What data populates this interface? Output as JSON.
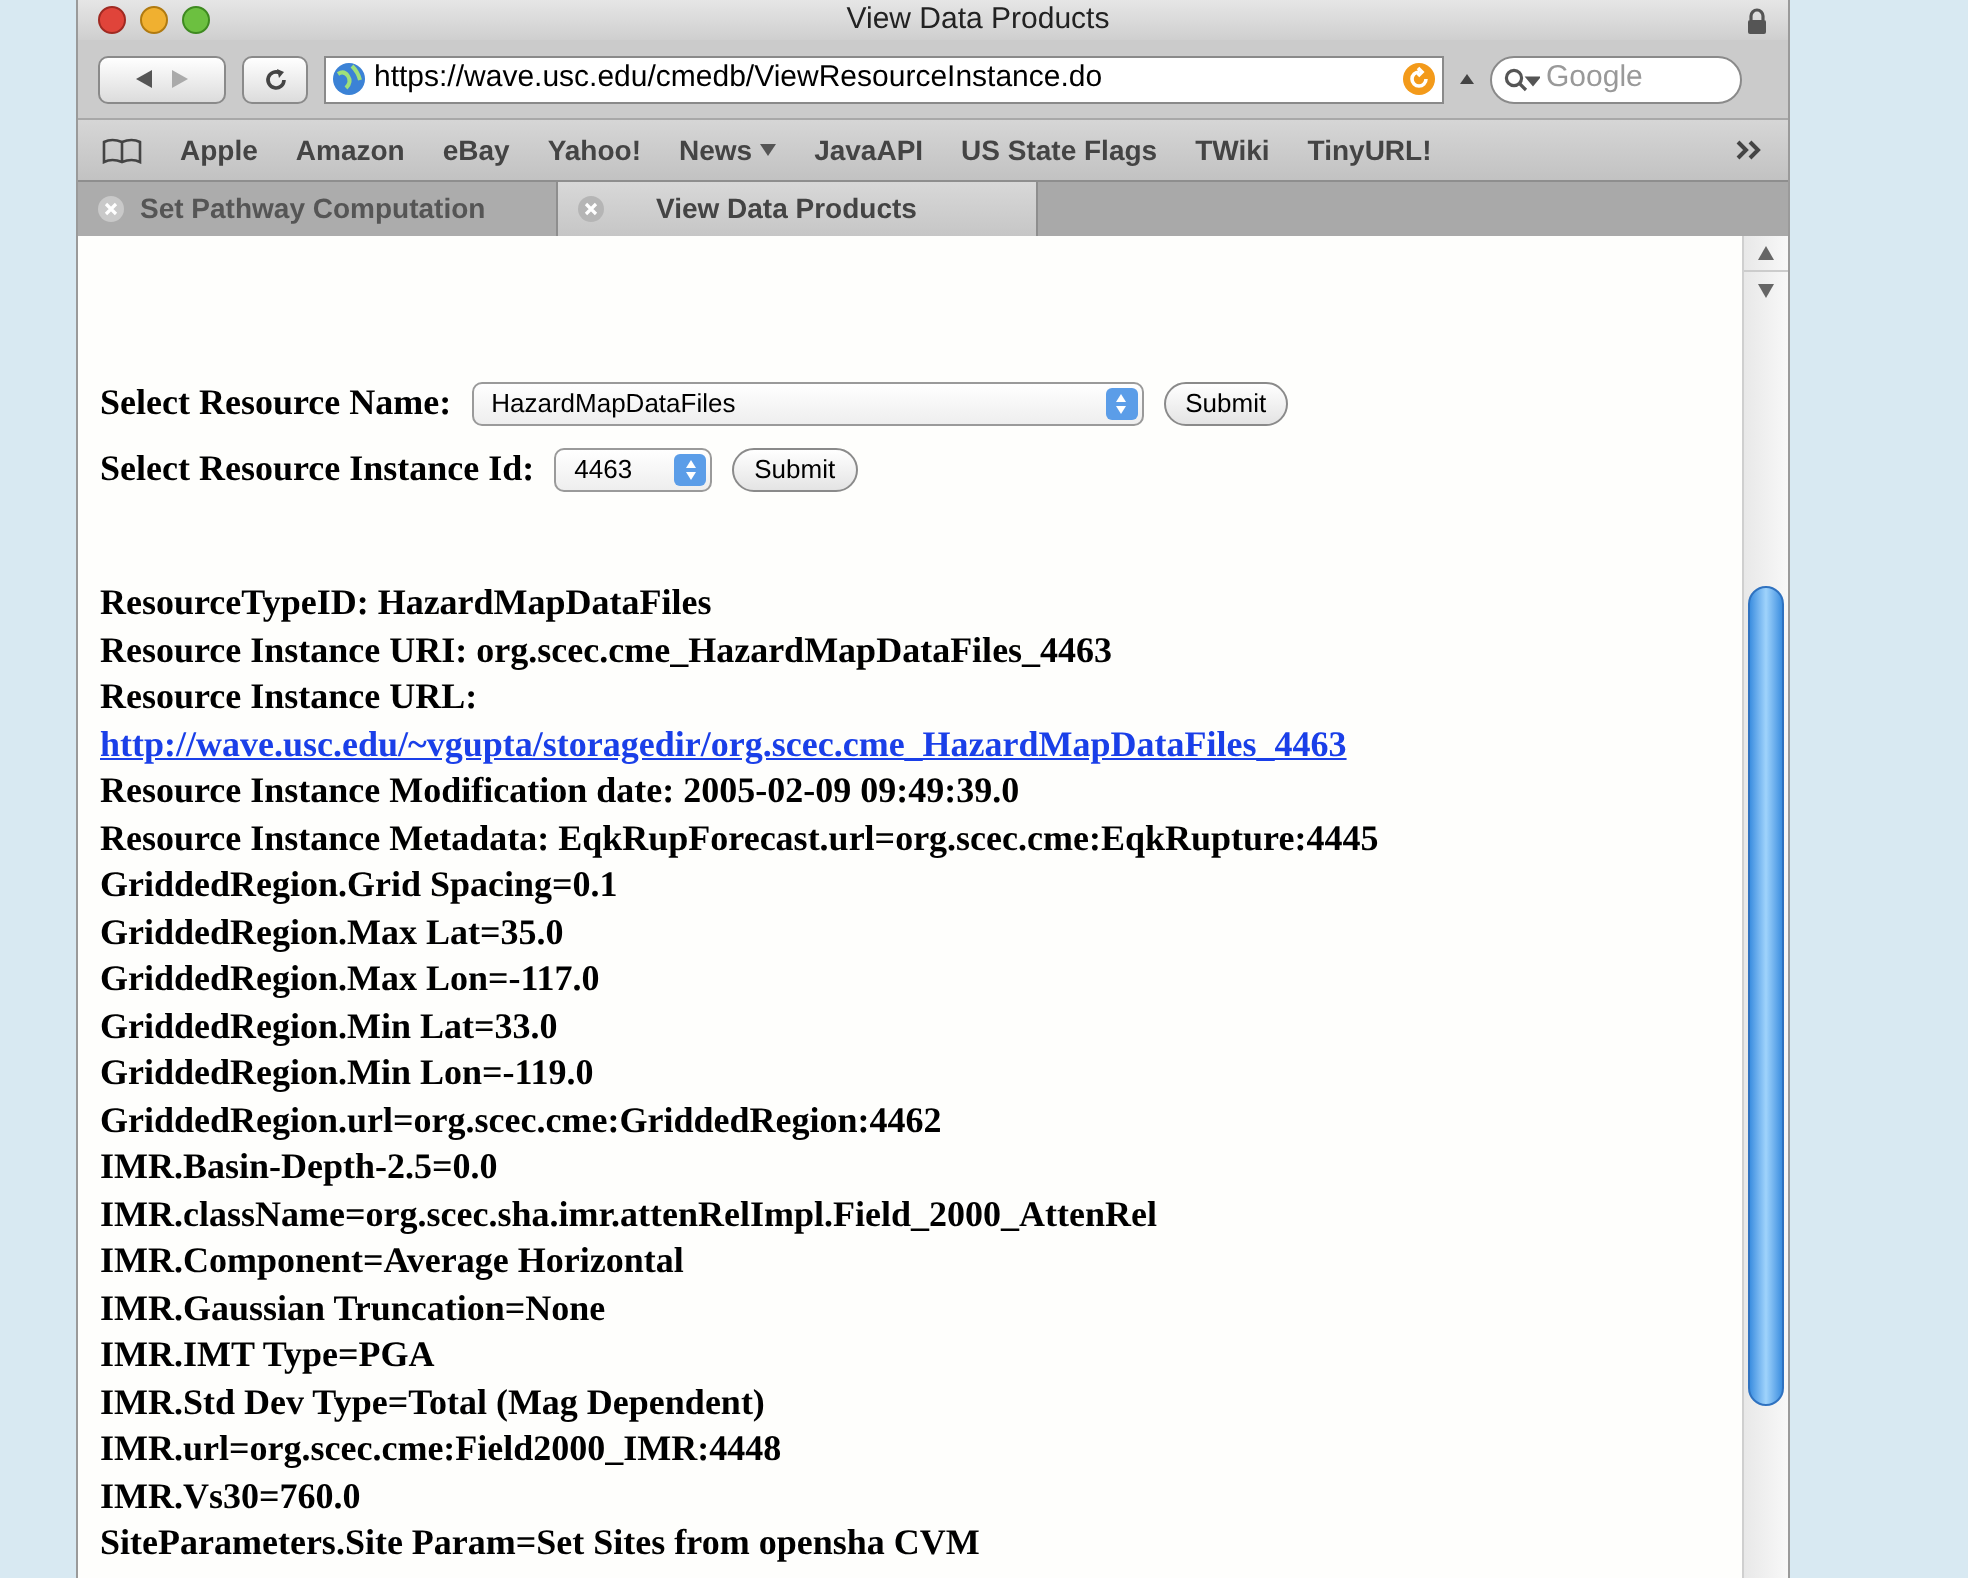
{
  "window": {
    "title": "View Data Products"
  },
  "toolbar": {
    "url": "https://wave.usc.edu/cmedb/ViewResourceInstance.do",
    "search": {
      "placeholder": "Google"
    }
  },
  "bookmarks": [
    {
      "label": "Apple",
      "menu": false
    },
    {
      "label": "Amazon",
      "menu": false
    },
    {
      "label": "eBay",
      "menu": false
    },
    {
      "label": "Yahoo!",
      "menu": false
    },
    {
      "label": "News",
      "menu": true
    },
    {
      "label": "JavaAPI",
      "menu": false
    },
    {
      "label": "US State Flags",
      "menu": false
    },
    {
      "label": "TWiki",
      "menu": false
    },
    {
      "label": "TinyURL!",
      "menu": false
    }
  ],
  "tabs": [
    {
      "label": "Set Pathway Computation",
      "selected": false
    },
    {
      "label": "View Data Products",
      "selected": true
    }
  ],
  "form": [
    {
      "label": "Select Resource Name:",
      "value": "HazardMapDataFiles",
      "kind": "wide",
      "button": "Submit"
    },
    {
      "label": "Select Resource Instance Id:",
      "value": "4463",
      "kind": "narrow",
      "button": "Submit"
    }
  ],
  "details": [
    {
      "kind": "text",
      "text": "ResourceTypeID: HazardMapDataFiles"
    },
    {
      "kind": "text",
      "text": "Resource Instance URI: org.scec.cme_HazardMapDataFiles_4463"
    },
    {
      "kind": "text",
      "text": "Resource Instance URL:"
    },
    {
      "kind": "link",
      "text": "http://wave.usc.edu/~vgupta/storagedir/org.scec.cme_HazardMapDataFiles_4463"
    },
    {
      "kind": "text",
      "text": "Resource Instance Modification date: 2005-02-09 09:49:39.0"
    },
    {
      "kind": "text",
      "text": "Resource Instance Metadata: EqkRupForecast.url=org.scec.cme:EqkRupture:4445"
    },
    {
      "kind": "text",
      "text": "GriddedRegion.Grid Spacing=0.1"
    },
    {
      "kind": "text",
      "text": "GriddedRegion.Max Lat=35.0"
    },
    {
      "kind": "text",
      "text": "GriddedRegion.Max Lon=-117.0"
    },
    {
      "kind": "text",
      "text": "GriddedRegion.Min Lat=33.0"
    },
    {
      "kind": "text",
      "text": "GriddedRegion.Min Lon=-119.0"
    },
    {
      "kind": "text",
      "text": "GriddedRegion.url=org.scec.cme:GriddedRegion:4462"
    },
    {
      "kind": "text",
      "text": "IMR.Basin-Depth-2.5=0.0"
    },
    {
      "kind": "text",
      "text": "IMR.className=org.scec.sha.imr.attenRelImpl.Field_2000_AttenRel"
    },
    {
      "kind": "text",
      "text": "IMR.Component=Average Horizontal"
    },
    {
      "kind": "text",
      "text": "IMR.Gaussian Truncation=None"
    },
    {
      "kind": "text",
      "text": "IMR.IMT Type=PGA"
    },
    {
      "kind": "text",
      "text": "IMR.Std Dev Type=Total (Mag Dependent)"
    },
    {
      "kind": "text",
      "text": "IMR.url=org.scec.cme:Field2000_IMR:4448"
    },
    {
      "kind": "text",
      "text": "IMR.Vs30=760.0"
    },
    {
      "kind": "text",
      "text": "SiteParameters.Site Param=Set Sites from opensha CVM"
    }
  ]
}
